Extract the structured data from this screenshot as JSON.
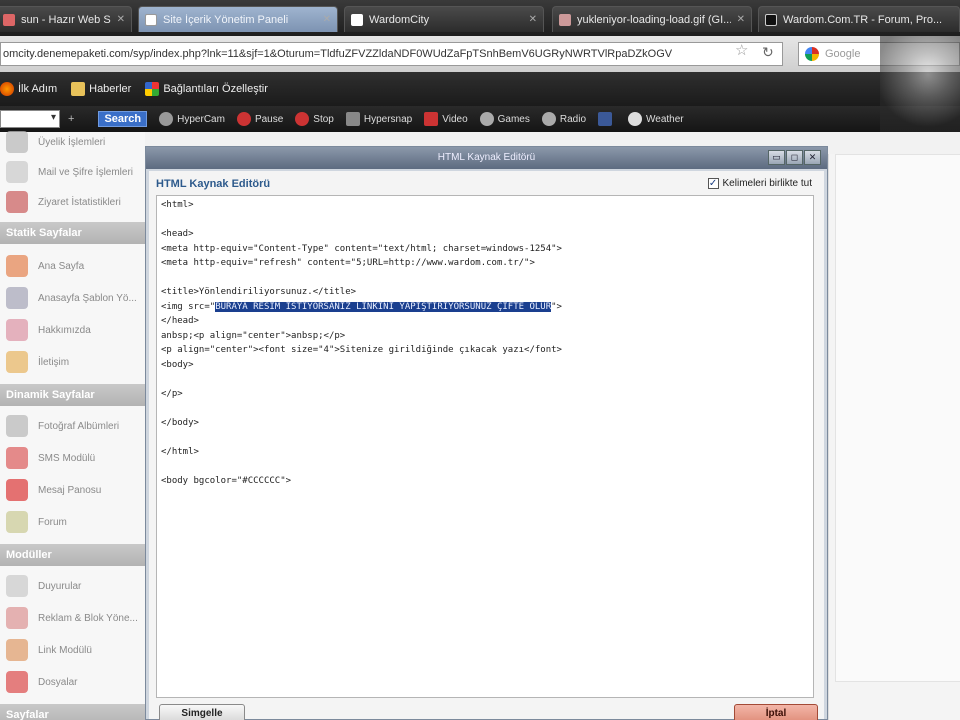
{
  "tabs": [
    {
      "label": "sun - Hazır Web Sitesi,...",
      "active": false,
      "icon": "page-icon"
    },
    {
      "label": "Site İçerik Yönetim Paneli",
      "active": true,
      "icon": "page-icon"
    },
    {
      "label": "WardomCity",
      "active": false,
      "icon": "page-icon"
    },
    {
      "label": "yukleniyor-loading-load.gif (GI...",
      "active": false,
      "icon": "image-icon"
    },
    {
      "label": "Wardom.Com.TR - Forum, Pro...",
      "active": false,
      "icon": "forum-icon"
    }
  ],
  "address": {
    "url": "omcity.denemepaketi.com/syp/index.php?lnk=11&sjf=1&Oturum=TldfuZFVZZldaNDF0WUdZaFpTSnhBemV6UGRyNWRTVlRpaDZkOGV",
    "search_placeholder": "Google"
  },
  "bookmarks": [
    {
      "label": "İlk Adım",
      "icon": "firefox-icon"
    },
    {
      "label": "Haberler",
      "icon": "folder-icon"
    },
    {
      "label": "Bağlantıları Özelleştir",
      "icon": "windows-icon"
    }
  ],
  "toolbar": {
    "search_label": "Search",
    "items": [
      "HyperCam",
      "Pause",
      "Stop",
      "Hypersnap",
      "Video",
      "Games",
      "Radio",
      "",
      "Weather"
    ]
  },
  "sidebar": {
    "items": [
      {
        "label": "Üyelik İşlemleri"
      },
      {
        "label": "Mail ve Şifre İşlemleri"
      },
      {
        "label": "Ziyaret İstatistikleri"
      },
      {
        "label": "Ana Sayfa"
      },
      {
        "label": "Anasayfa Şablon Yö..."
      },
      {
        "label": "Hakkımızda"
      },
      {
        "label": "İletişim"
      },
      {
        "label": "Fotoğraf Albümleri"
      },
      {
        "label": "SMS Modülü"
      },
      {
        "label": "Mesaj Panosu"
      },
      {
        "label": "Forum"
      },
      {
        "label": "Duyurular"
      },
      {
        "label": "Reklam & Blok Yöne..."
      },
      {
        "label": "Link Modülü"
      },
      {
        "label": "Dosyalar"
      }
    ],
    "headers": [
      "Statik Sayfalar",
      "Dinamik Sayfalar",
      "Modüller",
      "Sayfalar"
    ]
  },
  "dialog": {
    "title": "HTML Kaynak Editörü",
    "heading": "HTML Kaynak Editörü",
    "wrap_label": "Kelimeleri birlikte tut",
    "wrap_checked": true,
    "code_before": "<html>\n\n<head>\n<meta http-equiv=\"Content-Type\" content=\"text/html; charset=windows-1254\">\n<meta http-equiv=\"refresh\" content=\"5;URL=http://www.wardom.com.tr/\">\n\n<title>Yönlendiriliyorsunuz.</title>\n<img src=\"",
    "code_selected": "BURAYA RESİM İSTİYORSANIZ LİNKİNİ YAPIŞTIRIYORSUNUZ ÇİFTE OLUR",
    "code_after": "\">\n</head>\nanbsp;<p align=\"center\">anbsp;</p>\n<p align=\"center\"><font size=\"4\">Sitenize girildiğinde çıkacak yazı</font>\n<body>\n\n</p>\n\n</body>\n\n</html>\n\n<body bgcolor=\"#CCCCCC\">",
    "left_button": "Simgelle",
    "right_button": "İptal"
  }
}
